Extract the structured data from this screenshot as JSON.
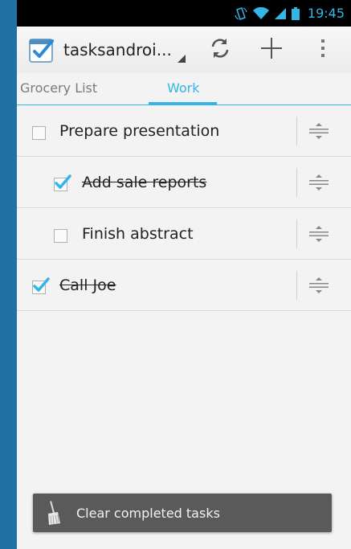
{
  "status_bar": {
    "time": "19:45"
  },
  "action_bar": {
    "title": "tasksandroi...",
    "icons": {
      "app": "task-app-icon",
      "sync": "sync-icon",
      "add": "add-icon",
      "overflow": "overflow-menu-icon"
    }
  },
  "tabs": [
    {
      "label": "Grocery List",
      "active": false
    },
    {
      "label": "Work",
      "active": true
    }
  ],
  "tasks": [
    {
      "title": "Prepare presentation",
      "completed": false,
      "indent": 0
    },
    {
      "title": "Add sale reports",
      "completed": true,
      "indent": 1
    },
    {
      "title": "Finish abstract",
      "completed": false,
      "indent": 1
    },
    {
      "title": "Call Joe",
      "completed": true,
      "indent": 0
    }
  ],
  "toast": {
    "text": "Clear completed tasks",
    "icon": "broom-icon"
  },
  "colors": {
    "accent": "#33b5e5",
    "toast_bg": "#5a5a5a",
    "background": "#f3f3f3"
  }
}
